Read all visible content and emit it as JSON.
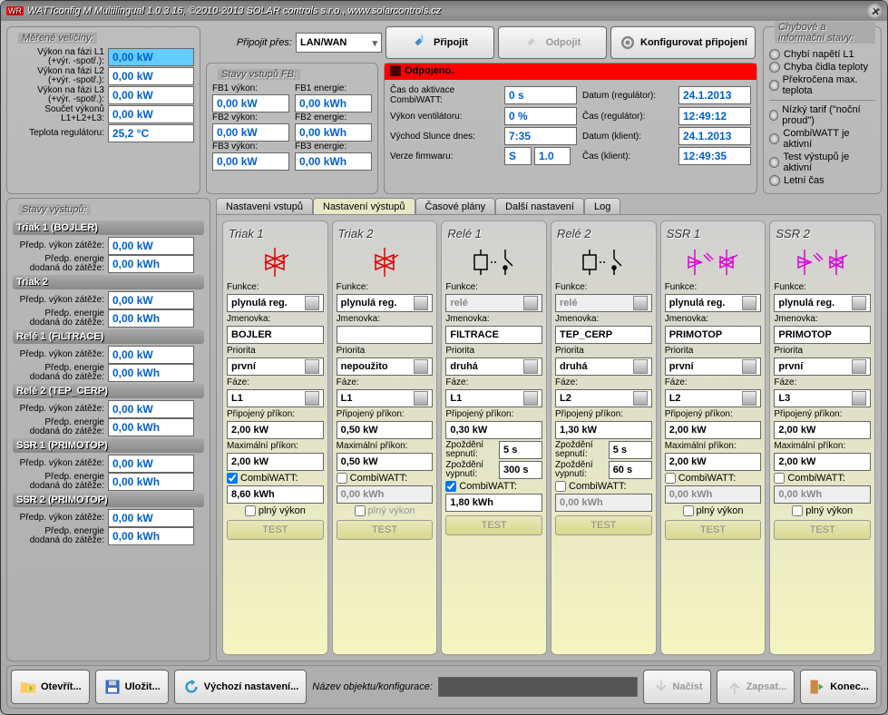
{
  "title": "WATTconfig M  Multilingual 1.0.3.16,  ©2010-2013 SOLAR controls s.r.o.,  www.solarcontrols.cz",
  "measured": {
    "title": "Měřené veličiny:",
    "rows": [
      {
        "label": "Výkon na fázi L1 (+výr. -spotř.):",
        "val": "0,00 kW",
        "hl": true
      },
      {
        "label": "Výkon na fázi L2 (+výr. -spotř.):",
        "val": "0,00 kW"
      },
      {
        "label": "Výkon na fázi L3 (+výr. -spotř.):",
        "val": "0,00 kW"
      },
      {
        "label": "Součet výkonů L1+L2+L3:",
        "val": "0,00 kW"
      },
      {
        "label": "Teplota regulátoru:",
        "val": "25,2 °C"
      }
    ]
  },
  "conn": {
    "via_label": "Připojit přes:",
    "via": "LAN/WAN",
    "connect": "Připojit",
    "disconnect": "Odpojit",
    "config": "Konfigurovat připojení"
  },
  "fb": {
    "title": "Stavy vstupů FB:",
    "rows": [
      {
        "p": "FB1 výkon:",
        "pv": "0,00 kW",
        "e": "FB1 energie:",
        "ev": "0,00 kWh"
      },
      {
        "p": "FB2 výkon:",
        "pv": "0,00 kW",
        "e": "FB2 energie:",
        "ev": "0,00 kWh"
      },
      {
        "p": "FB3 výkon:",
        "pv": "0,00 kW",
        "e": "FB3 energie:",
        "ev": "0,00 kWh"
      }
    ]
  },
  "status": {
    "text": "Odpojeno.",
    "items": [
      {
        "l": "Čas do aktivace CombiWATT:",
        "v": "0 s"
      },
      {
        "l": "Výkon ventilátoru:",
        "v": "0 %"
      },
      {
        "l": "Východ Slunce dnes:",
        "v": "7:35"
      },
      {
        "l": "Verze firmwaru:",
        "v": "S",
        "v2": "1.0"
      }
    ],
    "right": [
      {
        "l": "Datum (regulátor):",
        "v": "24.1.2013"
      },
      {
        "l": "Čas (regulátor):",
        "v": "12:49:12"
      },
      {
        "l": "Datum (klient):",
        "v": "24.1.2013"
      },
      {
        "l": "Čas (klient):",
        "v": "12:49:35"
      }
    ]
  },
  "errors": {
    "title": "Chybové a informační stavy:",
    "items": [
      "Chybí napětí L1",
      "Chyba čidla teploty",
      "Překročena max. teplota",
      "Nízký tarif (\"noční proud\")",
      "CombiWATT je aktivní",
      "Test výstupů je aktivní",
      "Letní čas"
    ]
  },
  "stavyv": {
    "title": "Stavy výstupů:",
    "groups": [
      {
        "name": "Triak 1 (BOJLER)",
        "p": "0,00 kW",
        "e": "0,00 kWh"
      },
      {
        "name": "Triak 2",
        "p": "0,00 kW",
        "e": "0,00 kWh"
      },
      {
        "name": "Relé 1 (FILTRACE)",
        "p": "0,00 kW",
        "e": "0,00 kWh"
      },
      {
        "name": "Relé 2 (TEP_CERP)",
        "p": "0,00 kW",
        "e": "0,00 kWh"
      },
      {
        "name": "SSR 1 (PRIMOTOP)",
        "p": "0,00 kW",
        "e": "0,00 kWh"
      },
      {
        "name": "SSR 2 (PRIMOTOP)",
        "p": "0,00 kW",
        "e": "0,00 kWh"
      }
    ],
    "plabel": "Předp. výkon zátěže:",
    "elabel": "Předp. energie dodaná do zátěže:"
  },
  "tabs": [
    "Nastavení vstupů",
    "Nastavení výstupů",
    "Časové plány",
    "Další nastavení",
    "Log"
  ],
  "activeTab": 1,
  "outputs": [
    {
      "name": "Triak 1",
      "type": "triac",
      "funkce": "plynulá reg.",
      "jmen": "BOJLER",
      "prio": "první",
      "faze": "L1",
      "prip": "2,00 kW",
      "max": "2,00 kW",
      "cw": true,
      "cwv": "8,60 kWh",
      "plny": false,
      "relay": false
    },
    {
      "name": "Triak 2",
      "type": "triac",
      "funkce": "plynulá reg.",
      "jmen": "",
      "prio": "nepoužito",
      "faze": "L1",
      "prip": "0,50 kW",
      "max": "0,50 kW",
      "cw": false,
      "cwv": "0,00 kWh",
      "plny": false,
      "relay": false
    },
    {
      "name": "Relé 1",
      "type": "relay",
      "funkce": "relé",
      "jmen": "FILTRACE",
      "prio": "druhá",
      "faze": "L1",
      "prip": "0,30 kW",
      "zs": "5 s",
      "zv": "300 s",
      "cw": true,
      "cwv": "1,80 kWh",
      "relay": true
    },
    {
      "name": "Relé 2",
      "type": "relay",
      "funkce": "relé",
      "jmen": "TEP_CERP",
      "prio": "druhá",
      "faze": "L2",
      "prip": "1,30 kW",
      "zs": "5 s",
      "zv": "60 s",
      "cw": false,
      "cwv": "0,00 kWh",
      "relay": true
    },
    {
      "name": "SSR 1",
      "type": "ssr",
      "funkce": "plynulá reg.",
      "jmen": "PRIMOTOP",
      "prio": "první",
      "faze": "L2",
      "prip": "2,00 kW",
      "max": "2,00 kW",
      "cw": false,
      "cwv": "0,00 kWh",
      "plny": false,
      "relay": false
    },
    {
      "name": "SSR 2",
      "type": "ssr",
      "funkce": "plynulá reg.",
      "jmen": "PRIMOTOP",
      "prio": "první",
      "faze": "L3",
      "prip": "2,00 kW",
      "max": "2,00 kW",
      "cw": false,
      "cwv": "0,00 kWh",
      "plny": false,
      "relay": false
    }
  ],
  "labels": {
    "funkce": "Funkce:",
    "jmen": "Jmenovka:",
    "prio": "Priorita",
    "faze": "Fáze:",
    "prip": "Připojený příkon:",
    "max": "Maximální příkon:",
    "zs": "Zpoždění sepnutí:",
    "zv": "Zpoždění vypnutí:",
    "cw": "CombiWATT:",
    "plny": "plný výkon",
    "test": "TEST"
  },
  "bottom": {
    "open": "Otevřít...",
    "save": "Uložit...",
    "default": "Výchozí nastavení...",
    "objlabel": "Název objektu/konfigurace:",
    "read": "Načíst",
    "write": "Zapsat...",
    "end": "Konec..."
  }
}
